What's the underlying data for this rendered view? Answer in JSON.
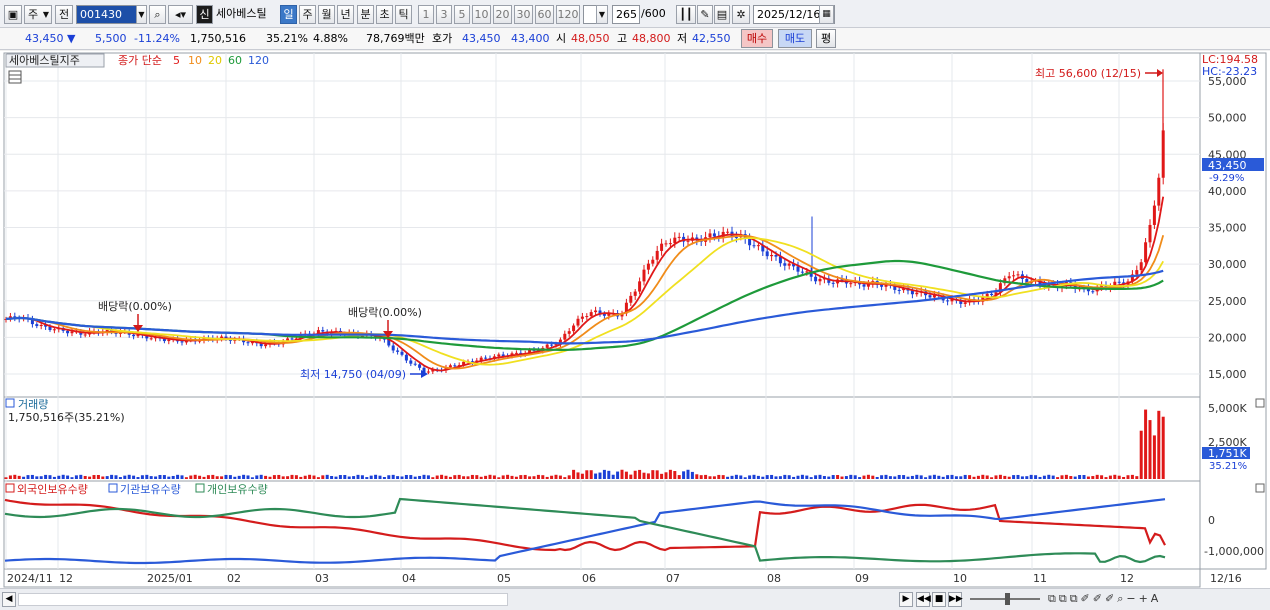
{
  "toolbar": {
    "market": "주",
    "prev": "전",
    "code": "001430",
    "stock_badge": "신",
    "stock_name": "세아베스틸",
    "periods": [
      "일",
      "주",
      "월",
      "년",
      "분",
      "초",
      "틱"
    ],
    "active_period": "일",
    "intervals": [
      "1",
      "3",
      "5",
      "10",
      "20",
      "30",
      "60",
      "120"
    ],
    "count": "265",
    "count_max": "/600",
    "date": "2025/12/16"
  },
  "quote": {
    "price": "43,450",
    "change": "5,500",
    "change_pct": "-11.24%",
    "volume": "1,750,516",
    "vol_ratio": "35.21%",
    "turnover": "4.88%",
    "amount": "78,769백만",
    "hoga_label": "호가",
    "hoga1": "43,450",
    "hoga2": "43,400",
    "open_label": "시",
    "open": "48,050",
    "high_label": "고",
    "high": "48,800",
    "low_label": "저",
    "low": "42,550",
    "buy": "매수",
    "sell": "매도",
    "eval": "평"
  },
  "price_pane": {
    "title": "세아베스틸지주",
    "ma_label": "종가 단순",
    "ma_periods": [
      "5",
      "10",
      "20",
      "60",
      "120"
    ],
    "ma_colors": [
      "#e01818",
      "#f08c1a",
      "#f0e020",
      "#1e9a3a",
      "#2a5ad8"
    ],
    "lc": "LC:194.58",
    "hc": "HC:-23.23",
    "current_price": "43,450",
    "current_pct": "-9.29%",
    "high_annot": "최고 56,600 (12/15)",
    "low_annot": "최저 14,750 (04/09)",
    "dividend1": "배당락(0.00%)",
    "dividend2": "배당락(0.00%)",
    "y_ticks": [
      "55,000",
      "50,000",
      "45,000",
      "40,000",
      "35,000",
      "30,000",
      "25,000",
      "20,000",
      "15,000"
    ]
  },
  "volume_pane": {
    "title": "거래량",
    "value": "1,750,516주(35.21%)",
    "y_ticks": [
      "5,000K",
      "2,500K"
    ],
    "current": "1,751K",
    "current_pct": "35.21%"
  },
  "holdings_pane": {
    "labels": [
      "외국인보유수량",
      "기관보유수량",
      "개인보유수량"
    ],
    "colors": [
      "#d41c1c",
      "#2a5ad8",
      "#2e8b57"
    ],
    "y_ticks": [
      "0",
      "-1,000,000"
    ]
  },
  "x_axis": {
    "labels": [
      "2024/11",
      "12",
      "2025/01",
      "02",
      "03",
      "04",
      "05",
      "06",
      "07",
      "08",
      "09",
      "10",
      "11",
      "12"
    ],
    "right_label": "12/16"
  }
}
